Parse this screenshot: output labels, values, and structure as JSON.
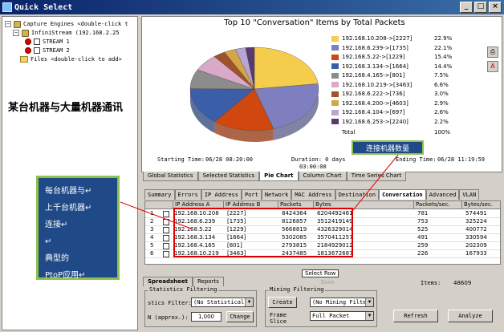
{
  "window": {
    "title": "Quick Select"
  },
  "tree": {
    "capture_engines": "Capture Engines <double-click t",
    "infinistream": "InfiniStream (192.168.2.25",
    "stream1": "STREAM 1",
    "stream2": "STREAM 2",
    "files": "Files <double-click to add>"
  },
  "caption_left": "某台机器与大量机器通讯",
  "chart_data": {
    "type": "pie",
    "title": "Top 10 \"Conversation\" Items by Total Packets",
    "categories": [
      "192.168.10.208->[2227]",
      "192.168.6.239->[1735]",
      "192.168.5.22->[1229]",
      "192.168.3.134->[1664]",
      "192.168.4.165->[801]",
      "192.168.10.219->[3463]",
      "192.168.6.222->[736]",
      "192.168.4.200->[4603]",
      "192.168.4.104->[697]",
      "192.168.6.253->[2240]"
    ],
    "values": [
      22.9,
      22.1,
      15.4,
      14.4,
      7.5,
      6.6,
      3.0,
      2.9,
      2.6,
      2.2
    ],
    "value_labels": [
      "22.9%",
      "22.1%",
      "15.4%",
      "14.4%",
      "7.5%",
      "6.6%",
      "3.0%",
      "2.9%",
      "2.6%",
      "2.2%"
    ],
    "total_label": "Total",
    "total_value": "100%",
    "colors": [
      "#f4cd4c",
      "#7f7fbf",
      "#d0470f",
      "#3a5fa8",
      "#8c8c8c",
      "#d9a9c8",
      "#a0522d",
      "#d3a648",
      "#b7a6d2",
      "#5a3b70"
    ]
  },
  "times": {
    "start_label": "Starting Time:",
    "start_value": "06/28  08:20:00",
    "duration_label": "Duration: 0 days",
    "duration_value": "03:00:00",
    "ending_label": "Ending Time:",
    "ending_value": "06/28  11:19:59"
  },
  "callout_top": "连接机器数量",
  "chart_tabs": [
    "Global Statistics",
    "Selected Statistics",
    "Pie Chart",
    "Column Chart",
    "Time Series Chart"
  ],
  "table_tabs": [
    "Summary",
    "Errors",
    "IP Address",
    "Port",
    "Network",
    "MAC Address",
    "Destination",
    "Conversation",
    "Advanced",
    "VLAN"
  ],
  "table": {
    "headers": [
      "IP Address A",
      "IP Address B",
      "Packets",
      "Bytes",
      "Packets/sec.",
      "Bytes/sec."
    ],
    "rows": [
      {
        "n": "1",
        "a": "192.168.10.208",
        "b": "[2227]",
        "p": "8424364",
        "by": "6204492461",
        "ps": "781",
        "bs": "574491"
      },
      {
        "n": "2",
        "a": "192.168.6.239",
        "b": "[1735]",
        "p": "8126857",
        "by": "3512419149",
        "ps": "753",
        "bs": "325224"
      },
      {
        "n": "3",
        "a": "192.168.5.22",
        "b": "[1229]",
        "p": "5668819",
        "by": "4326329014",
        "ps": "525",
        "bs": "400772"
      },
      {
        "n": "4",
        "a": "192.168.3.134",
        "b": "[1664]",
        "p": "5302085",
        "by": "3570411257",
        "ps": "491",
        "bs": "330594"
      },
      {
        "n": "5",
        "a": "192.168.4.165",
        "b": "[801]",
        "p": "2793815",
        "by": "2184929012",
        "ps": "259",
        "bs": "202309"
      },
      {
        "n": "6",
        "a": "192.168.10.219",
        "b": "[3463]",
        "p": "2437485",
        "by": "1813672687",
        "ps": "226",
        "bs": "167933"
      }
    ]
  },
  "callout_left": {
    "lines": [
      "每台机器与↵",
      "上千台机器↵",
      "连接↵",
      "↵",
      "典型的",
      "PtoP应用↵"
    ]
  },
  "status": {
    "select_row": "Select Row",
    "items_label": "Items:",
    "items_value": "48609",
    "done": "Done"
  },
  "bottom_tabs": [
    "Spreadsheet",
    "Reports"
  ],
  "stats_filter": {
    "group_label": "Statistics Filtering",
    "filter_label": "stics Filter:",
    "filter_value": "(No Statistical",
    "n_label": "N (approx.):",
    "n_value": "1,000",
    "change_btn": "Change"
  },
  "mining_filter": {
    "group_label": "Mining Filtering",
    "create_btn": "Create",
    "mining_value": "(No Mining Filte",
    "frame_label": "Frame Slice",
    "frame_value": "Full Packet"
  },
  "actions": {
    "refresh": "Refresh",
    "analyze": "Analyze"
  }
}
